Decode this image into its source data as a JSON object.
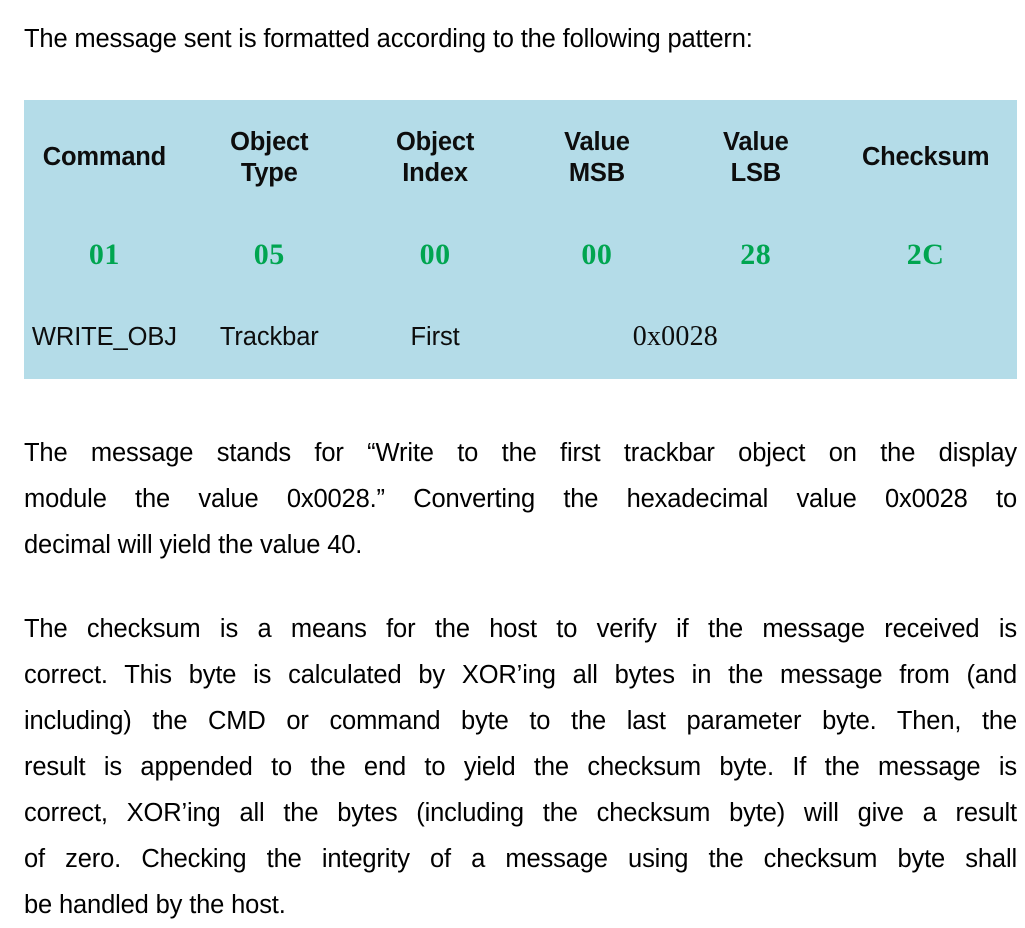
{
  "document": {
    "lead_paragraph": "The message sent is formatted according to the following pattern:",
    "paragraph_2": {
      "lines": [
        "The message stands for “Write to the first trackbar object on the display",
        "module the value 0x0028.” Converting the hexadecimal value 0x0028 to",
        "decimal will yield the value 40."
      ]
    },
    "paragraph_3": {
      "lines": [
        "The checksum is a means for the host to verify if the message received is",
        "correct. This byte is calculated by XOR’ing all bytes in the message from (and",
        "including) the CMD or command byte to the last parameter byte. Then, the",
        "result is appended to the end to yield the checksum byte. If the message is",
        "correct, XOR’ing all the bytes (including the checksum byte) will give a result",
        "of zero. Checking the integrity of a message using the checksum byte shall",
        "be handled by the host."
      ]
    }
  },
  "message_table": {
    "background_color": "#b4dce8",
    "hex_value_color": "#00a550",
    "headers": [
      {
        "line1": "Command",
        "line2": ""
      },
      {
        "line1": "Object",
        "line2": "Type"
      },
      {
        "line1": "Object",
        "line2": "Index"
      },
      {
        "line1": "Value",
        "line2": "MSB"
      },
      {
        "line1": "Value",
        "line2": "LSB"
      },
      {
        "line1": "Checksum",
        "line2": ""
      }
    ],
    "hex_values": [
      "01",
      "05",
      "00",
      "00",
      "28",
      "2C"
    ],
    "descriptions": {
      "command": "WRITE_OBJ",
      "object_type": "Trackbar",
      "object_index": "First",
      "value_merged": "0x0028",
      "checksum": ""
    }
  }
}
